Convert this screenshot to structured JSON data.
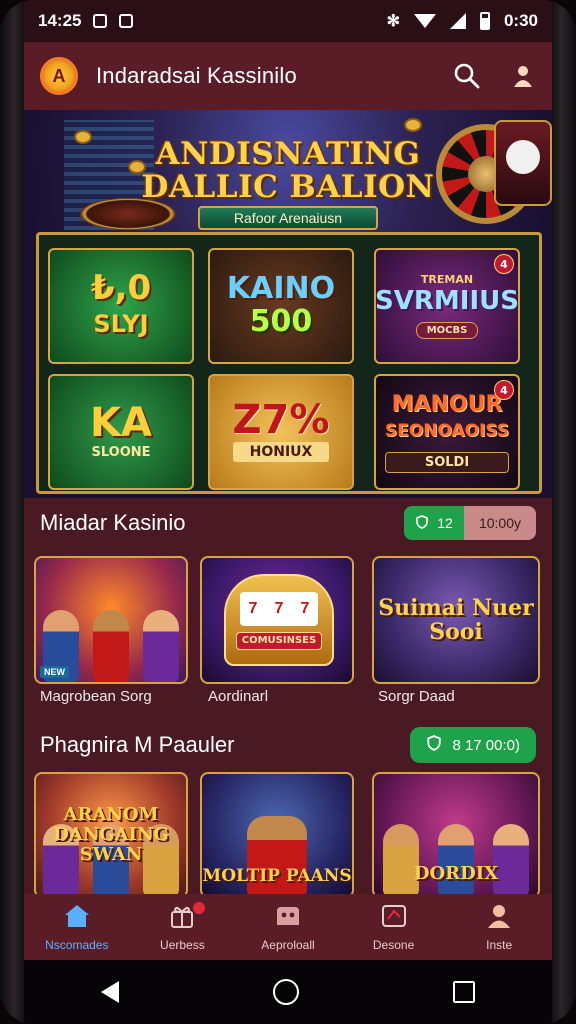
{
  "status_bar": {
    "time": "14:25",
    "battery_text": "0:30"
  },
  "app": {
    "title": "Indaradsai Kassinilo",
    "logo_glyph": "A"
  },
  "banner": {
    "title_line1": "ANDISNATING",
    "title_line2": "DALLIC BALION",
    "ribbon": "Rafoor Arenaiusn",
    "tiles": [
      {
        "line1": "₺,0",
        "line2": "SLYJ",
        "sub": ""
      },
      {
        "line1": "KAINO",
        "line2": "500",
        "sub": ""
      },
      {
        "line1": "TREMAN",
        "line2": "SVRMIIUS",
        "sub": "MOCBS"
      },
      {
        "line1": "KA",
        "line2": "",
        "sub": "SLOONE"
      },
      {
        "line1": "Z7%",
        "line2": "",
        "sub": "HONIUX"
      },
      {
        "line1": "MANOUR",
        "line2": "SEONOAOISS",
        "sub": "SOLDI"
      }
    ],
    "badges": [
      "4",
      "4"
    ]
  },
  "section1": {
    "title": "Miadar Kasinio",
    "toggle_a": "12",
    "toggle_b": "10:00y",
    "cards": [
      {
        "label": "Magrobean Sorg",
        "text": ""
      },
      {
        "label": "Aordinarl",
        "text": "COMUSINSES"
      },
      {
        "label": "Sorgr Daad",
        "text_1": "Suimai Nuer",
        "text_2": "Sooi"
      }
    ]
  },
  "section2": {
    "title": "Phagnira M Paauler",
    "pill": "8 17 00:0)",
    "cards": [
      {
        "text_1": "ARANOM",
        "text_2": "DANGAING",
        "text_3": "SWAN"
      },
      {
        "text": "MOLTIP PAANS"
      },
      {
        "text": "DORDIX"
      }
    ]
  },
  "bottom_nav": [
    {
      "label": "Nscomades",
      "icon": "home-icon"
    },
    {
      "label": "Uerbess",
      "icon": "gift-icon"
    },
    {
      "label": "Aeproloall",
      "icon": "wallet-icon"
    },
    {
      "label": "Desone",
      "icon": "card-icon"
    },
    {
      "label": "Inste",
      "icon": "profile-icon"
    }
  ],
  "colors": {
    "accent_green": "#1fa34a",
    "header_bg": "#5a1d28",
    "screen_bg": "#4a1a24",
    "active_nav": "#5ab0ff"
  }
}
